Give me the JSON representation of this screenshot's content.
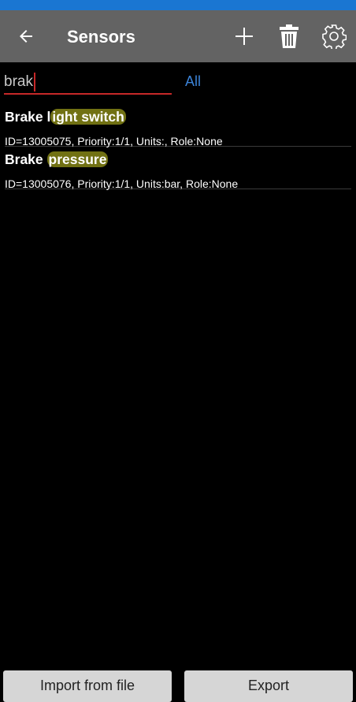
{
  "header": {
    "title": "Sensors"
  },
  "search": {
    "value": "brak",
    "filter_label": "All"
  },
  "sensors": [
    {
      "name_prefix": "Brake l",
      "name_highlight": "ight switch",
      "details": "ID=13005075, Priority:1/1, Units:, Role:None"
    },
    {
      "name_prefix": "Brake ",
      "name_highlight": "pressure",
      "details": "ID=13005076, Priority:1/1, Units:bar, Role:None"
    }
  ],
  "footer": {
    "import_label": "Import from file",
    "export_label": "Export"
  },
  "colors": {
    "status_bar": "#1a76d2",
    "app_bar": "#636363",
    "accent_link": "#3b82d6",
    "input_underline": "#c62828",
    "highlight": "#cdcd23"
  }
}
